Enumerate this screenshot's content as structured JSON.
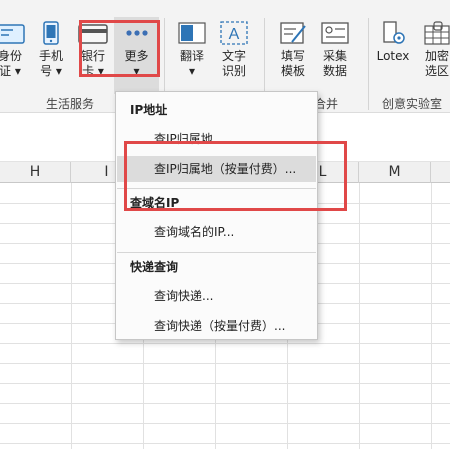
{
  "ribbon": {
    "buttons": [
      {
        "id": "identity",
        "label_line1": "身份",
        "label_line2": "证 ▾",
        "icon": "id-card-icon"
      },
      {
        "id": "phone",
        "label_line1": "手机",
        "label_line2": "号 ▾",
        "icon": "phone-icon"
      },
      {
        "id": "bankcard",
        "label_line1": "银行",
        "label_line2": "卡 ▾",
        "icon": "bank-card-icon"
      },
      {
        "id": "more",
        "label_line1": "更多",
        "label_line2": "▾",
        "icon": "more-dots-icon"
      },
      {
        "id": "translate",
        "label_line1": "翻译",
        "label_line2": "▾",
        "icon": "translate-icon"
      },
      {
        "id": "ocr",
        "label_line1": "文字",
        "label_line2": "识别",
        "icon": "text-recognition-icon"
      },
      {
        "id": "fill-template",
        "label_line1": "填写",
        "label_line2": "模板",
        "icon": "fill-template-icon"
      },
      {
        "id": "collect-data",
        "label_line1": "采集",
        "label_line2": "数据",
        "icon": "collect-data-icon"
      },
      {
        "id": "lotex",
        "label_line1": "Lotex",
        "label_line2": "",
        "icon": "lotex-icon"
      },
      {
        "id": "encrypt",
        "label_line1": "加密",
        "label_line2": "选区",
        "icon": "encrypt-icon"
      }
    ],
    "groups": {
      "life_services": "生活服务",
      "merge": "合并",
      "creative_lab": "创意实验室"
    }
  },
  "sheet": {
    "columns": [
      "H",
      "I",
      "L",
      "M"
    ]
  },
  "menu": {
    "sections": [
      {
        "header": "IP地址",
        "items": [
          "查IP归属地",
          "查IP归属地（按量付费）..."
        ]
      },
      {
        "header": "查域名IP",
        "items": [
          "查询域名的IP..."
        ]
      },
      {
        "header": "快递查询",
        "items": [
          "查询快递...",
          "查询快递（按量付费）..."
        ]
      }
    ],
    "hovered_item": "查IP归属地（按量付费）..."
  },
  "colors": {
    "ribbon_bg": "#f3f3f3",
    "highlight_red": "#e04848",
    "icon_blue": "#2e75b6",
    "hover_gray": "#dcdcdc"
  }
}
